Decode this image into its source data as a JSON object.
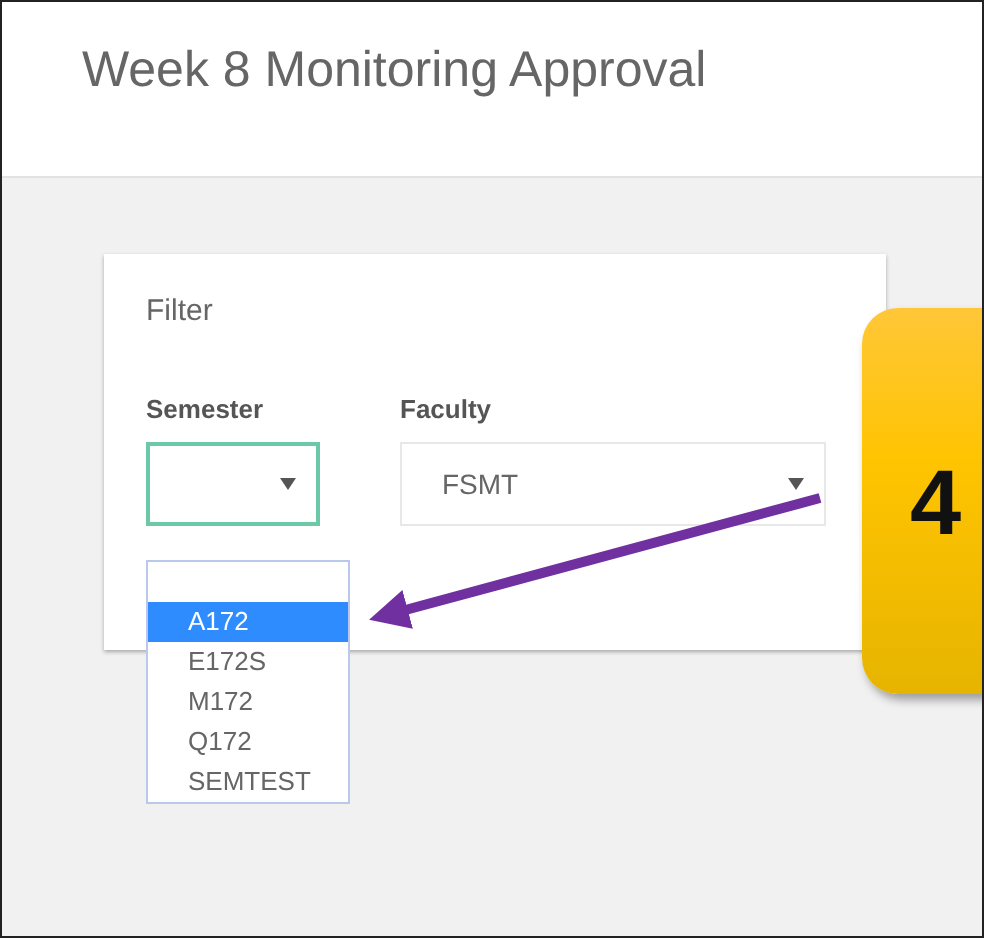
{
  "page": {
    "title": "Week 8 Monitoring Approval"
  },
  "filter": {
    "title": "Filter",
    "semester": {
      "label": "Semester",
      "expanded": true,
      "options": [
        {
          "label": "A172",
          "selected": true
        },
        {
          "label": "E172S",
          "selected": false
        },
        {
          "label": "M172",
          "selected": false
        },
        {
          "label": "Q172",
          "selected": false
        },
        {
          "label": "SEMTEST",
          "selected": false
        }
      ]
    },
    "faculty": {
      "label": "Faculty",
      "value": "FSMT"
    }
  },
  "callout": {
    "number": "4"
  }
}
